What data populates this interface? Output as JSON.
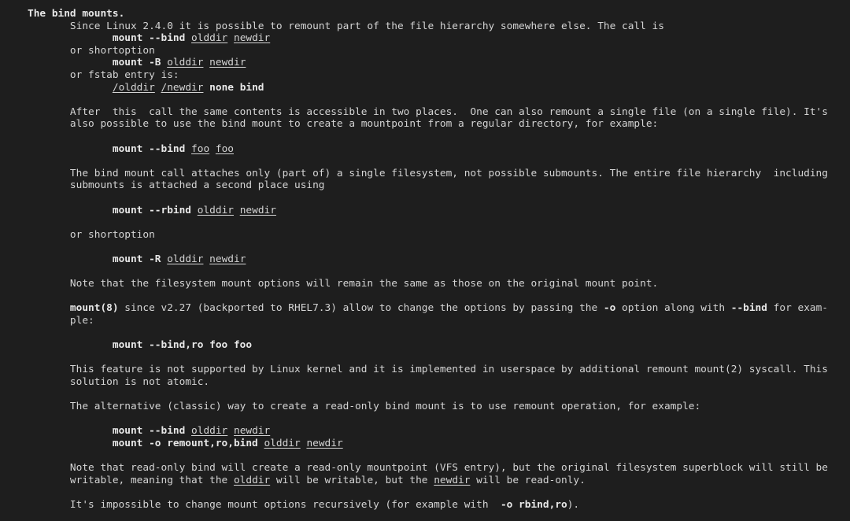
{
  "theme": {
    "background": "#1e1e1e",
    "text": "#d4d4d4",
    "bold_text": "#e8e8e8"
  },
  "manpage": {
    "section_title": "The bind mounts.",
    "intro": {
      "line1": "Since Linux 2.4.0 it is possible to remount part of the file hierarchy somewhere else. The call is",
      "cmd1": {
        "cmd": "mount --bind",
        "args": [
          "olddir",
          "newdir"
        ]
      },
      "or_short": "or shortoption",
      "cmd2": {
        "cmd": "mount -B",
        "args": [
          "olddir",
          "newdir"
        ]
      },
      "or_fstab": "or fstab entry is:",
      "fstab": {
        "args": [
          "/olddir",
          "/newdir"
        ],
        "rest": "none bind"
      }
    },
    "para_after": [
      "After  this  call the same contents is accessible in two places.  One can also remount a single file (on a single file). It's",
      "also possible to use the bind mount to create a mountpoint from a regular directory, for example:"
    ],
    "cmd_foo": {
      "cmd": "mount --bind",
      "args": [
        "foo",
        "foo"
      ]
    },
    "para_attach": [
      "The bind mount call attaches only (part of) a single filesystem, not possible submounts. The entire file hierarchy  including",
      "submounts is attached a second place using"
    ],
    "cmd_rbind": {
      "cmd": "mount --rbind",
      "args": [
        "olddir",
        "newdir"
      ]
    },
    "or_short2": "or shortoption",
    "cmd_R": {
      "cmd": "mount -R",
      "args": [
        "olddir",
        "newdir"
      ]
    },
    "note_options": "Note that the filesystem mount options will remain the same as those on the original mount point.",
    "para_v227": {
      "bold_start": "mount(8)",
      "text1": " since v2.27 (backported to RHEL7.3) allow to change the options by passing the ",
      "bold_o": "-o",
      "text2": " option along with ",
      "bold_bind": "--bind",
      "text3": " for exam-",
      "line2": "ple:"
    },
    "cmd_bindro": "mount --bind,ro foo foo",
    "para_feature": [
      "This feature is not supported by Linux kernel and it is implemented in userspace by additional remount mount(2) syscall. This",
      "solution is not atomic."
    ],
    "para_alternative": "The alternative (classic) way to create a read-only bind mount is to use remount operation, for example:",
    "cmd_alt1": {
      "cmd": "mount --bind",
      "args": [
        "olddir",
        "newdir"
      ]
    },
    "cmd_alt2": {
      "cmd": "mount -o remount,ro,bind",
      "args": [
        "olddir",
        "newdir"
      ]
    },
    "para_note_ro": {
      "line1": "Note that read-only bind will create a read-only mountpoint (VFS entry), but the original filesystem superblock will still be",
      "line2_a": "writable, meaning that the ",
      "line2_olddir": "olddir",
      "line2_b": " will be writable, but the ",
      "line2_newdir": "newdir",
      "line2_c": " will be read-only."
    },
    "para_recursive": {
      "text": "It's impossible to change mount options recursively (for example with  ",
      "bold": "-o rbind,ro",
      "end": ")."
    }
  }
}
